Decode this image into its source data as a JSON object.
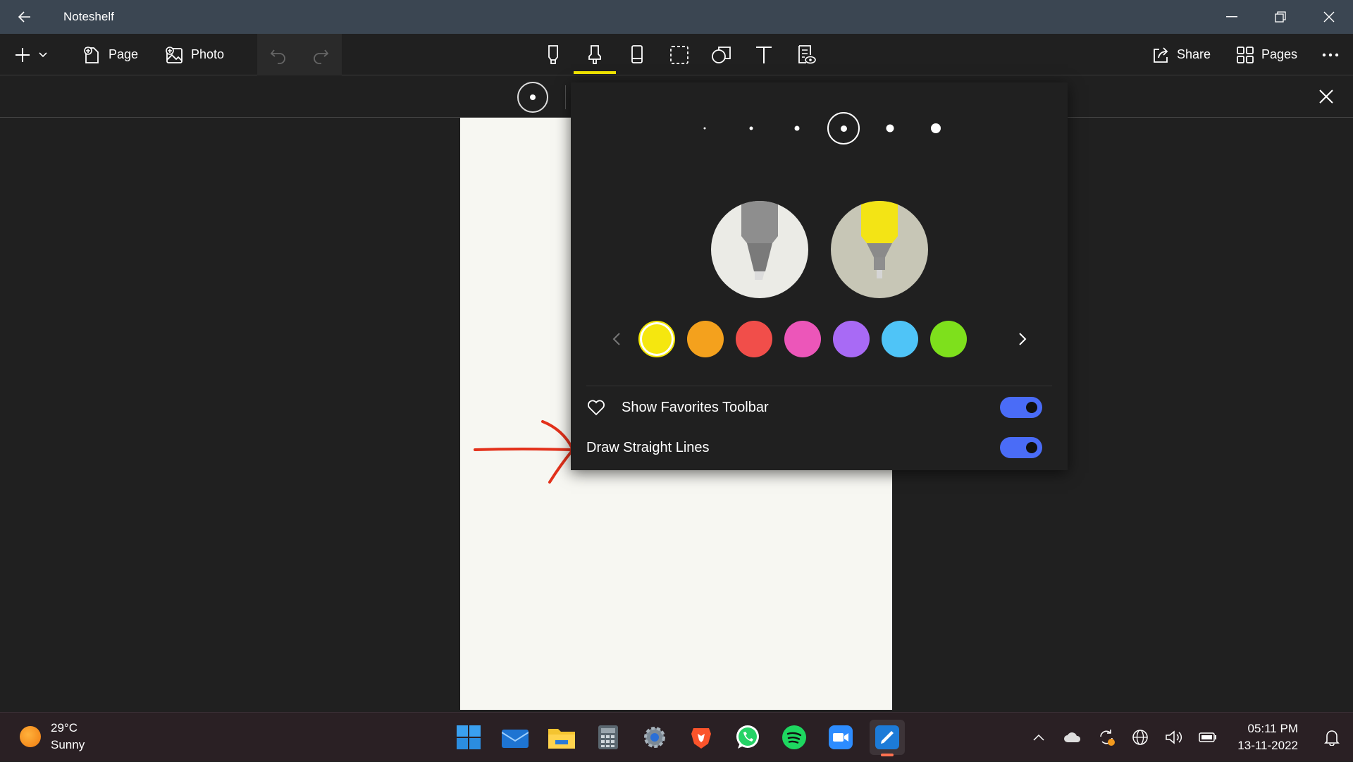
{
  "window": {
    "title": "Noteshelf"
  },
  "toolbar": {
    "page_label": "Page",
    "photo_label": "Photo",
    "share_label": "Share",
    "pages_label": "Pages"
  },
  "pen_popover": {
    "sizes": [
      1,
      2,
      3,
      4,
      5,
      6
    ],
    "selected_size": 4,
    "pen_types": [
      "pen",
      "highlighter"
    ],
    "selected_pen_type": "highlighter",
    "colors": [
      "#f5e70f",
      "#f4a11d",
      "#f14e4a",
      "#ec56b9",
      "#a86af5",
      "#4fc4f7",
      "#7ee01c"
    ],
    "selected_color": "#f5e70f",
    "show_favorites_label": "Show Favorites Toolbar",
    "show_favorites_on": true,
    "draw_straight_label": "Draw Straight Lines",
    "draw_straight_on": true
  },
  "taskbar": {
    "temperature": "29°C",
    "condition": "Sunny",
    "time": "05:11 PM",
    "date": "13-11-2022"
  }
}
